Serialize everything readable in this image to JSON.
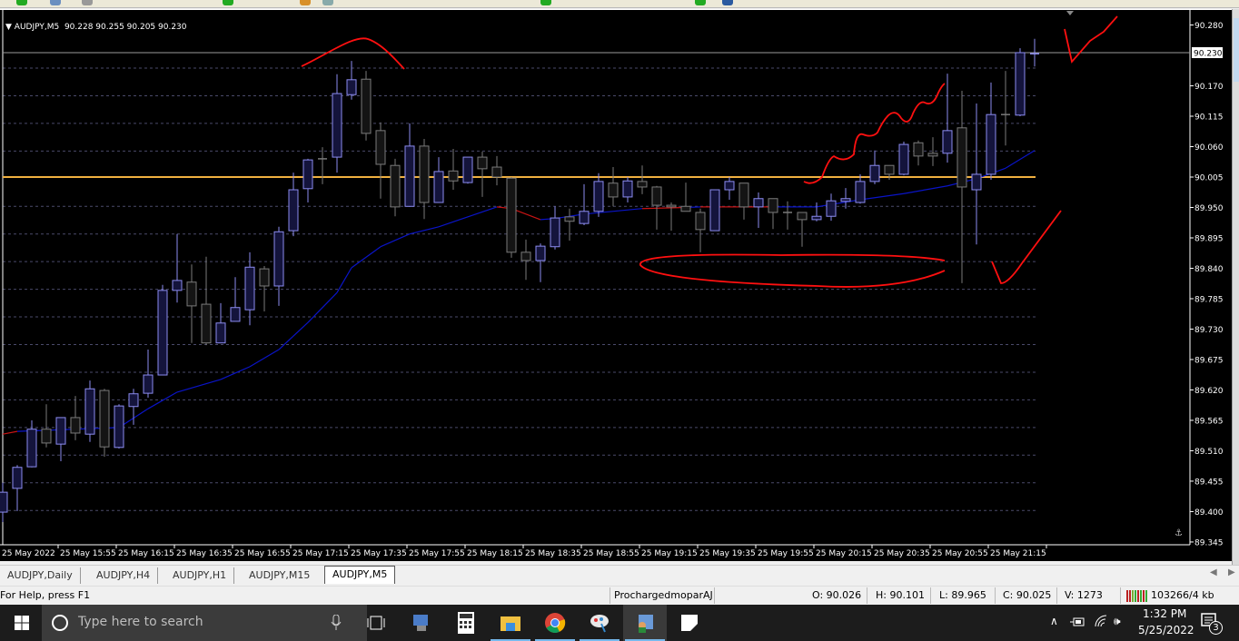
{
  "chart": {
    "symbol_label": "AUDJPY,M5",
    "ohlc_label": "90.228 90.255 90.205 90.230",
    "current_price": "90.230",
    "horizontal_line_price": 90.005,
    "colors": {
      "background": "#000000",
      "bull_outline": "#8c8cf0",
      "bull_fill": "#14143c",
      "bear_outline": "#7a7a7a",
      "bear_fill": "#141414",
      "ma_line": "#0a14c8",
      "ma_line_alt": "#c81414",
      "horizontal_line": "#f0b040",
      "grid": "#4a4a6a",
      "annotation": "#ff1010"
    }
  },
  "chart_data": {
    "type": "candlestick",
    "title": "AUDJPY,M5",
    "grid": true,
    "ylim": [
      89.345,
      90.305
    ],
    "y_tick_labels": [
      "90.280",
      "90.170",
      "90.115",
      "90.060",
      "90.005",
      "89.950",
      "89.895",
      "89.840",
      "89.785",
      "89.730",
      "89.675",
      "89.620",
      "89.565",
      "89.510",
      "89.455",
      "89.400",
      "89.345"
    ],
    "x_tick_labels": [
      "25 May 2022",
      "25 May 15:55",
      "25 May 16:15",
      "25 May 16:35",
      "25 May 16:55",
      "25 May 17:15",
      "25 May 17:35",
      "25 May 17:55",
      "25 May 18:15",
      "25 May 18:35",
      "25 May 18:55",
      "25 May 19:15",
      "25 May 19:35",
      "25 May 19:55",
      "25 May 20:15",
      "25 May 20:35",
      "25 May 20:55",
      "25 May 21:15"
    ],
    "candles_ohlc": [
      [
        89.399,
        89.452,
        89.381,
        89.435
      ],
      [
        89.442,
        89.484,
        89.401,
        89.48
      ],
      [
        89.481,
        89.565,
        89.48,
        89.549
      ],
      [
        89.549,
        89.594,
        89.516,
        89.524
      ],
      [
        89.522,
        89.57,
        89.491,
        89.57
      ],
      [
        89.57,
        89.609,
        89.529,
        89.542
      ],
      [
        89.54,
        89.637,
        89.526,
        89.622
      ],
      [
        89.619,
        89.622,
        89.499,
        89.517
      ],
      [
        89.516,
        89.594,
        89.514,
        89.591
      ],
      [
        89.59,
        89.622,
        89.557,
        89.613
      ],
      [
        89.614,
        89.693,
        89.606,
        89.647
      ],
      [
        89.647,
        89.81,
        89.647,
        89.8
      ],
      [
        89.8,
        89.902,
        89.778,
        89.818
      ],
      [
        89.815,
        89.847,
        89.705,
        89.772
      ],
      [
        89.775,
        89.861,
        89.701,
        89.705
      ],
      [
        89.705,
        89.777,
        89.705,
        89.741
      ],
      [
        89.744,
        89.824,
        89.744,
        89.769
      ],
      [
        89.765,
        89.869,
        89.737,
        89.842
      ],
      [
        89.839,
        89.844,
        89.762,
        89.808
      ],
      [
        89.808,
        89.915,
        89.772,
        89.906
      ],
      [
        89.908,
        90.013,
        89.898,
        89.982
      ],
      [
        89.984,
        90.038,
        89.959,
        90.036
      ],
      [
        90.038,
        90.059,
        89.992,
        90.038
      ],
      [
        90.041,
        90.191,
        90.013,
        90.156
      ],
      [
        90.154,
        90.215,
        90.145,
        90.181
      ],
      [
        90.182,
        90.197,
        90.071,
        90.084
      ],
      [
        90.089,
        90.104,
        89.966,
        90.028
      ],
      [
        90.026,
        90.038,
        89.934,
        89.951
      ],
      [
        89.952,
        90.102,
        89.951,
        90.061
      ],
      [
        90.061,
        90.074,
        89.929,
        89.959
      ],
      [
        89.959,
        90.041,
        89.959,
        90.015
      ],
      [
        90.016,
        90.056,
        89.982,
        89.998
      ],
      [
        89.995,
        90.041,
        89.993,
        90.041
      ],
      [
        90.041,
        90.051,
        89.969,
        90.02
      ],
      [
        90.023,
        90.043,
        89.99,
        90.005
      ],
      [
        90.003,
        90.005,
        89.859,
        89.869
      ],
      [
        89.869,
        89.892,
        89.819,
        89.854
      ],
      [
        89.854,
        89.885,
        89.815,
        89.88
      ],
      [
        89.879,
        89.952,
        89.874,
        89.931
      ],
      [
        89.933,
        89.948,
        89.89,
        89.925
      ],
      [
        89.921,
        89.992,
        89.918,
        89.943
      ],
      [
        89.943,
        90.012,
        89.933,
        89.997
      ],
      [
        89.994,
        90.023,
        89.952,
        89.969
      ],
      [
        89.969,
        90.005,
        89.959,
        89.998
      ],
      [
        89.997,
        90.026,
        89.974,
        89.987
      ],
      [
        89.987,
        89.989,
        89.91,
        89.954
      ],
      [
        89.954,
        89.959,
        89.908,
        89.951
      ],
      [
        89.952,
        89.995,
        89.943,
        89.943
      ],
      [
        89.941,
        89.948,
        89.869,
        89.91
      ],
      [
        89.908,
        89.982,
        89.908,
        89.982
      ],
      [
        89.982,
        90.005,
        89.964,
        89.997
      ],
      [
        89.994,
        89.994,
        89.928,
        89.951
      ],
      [
        89.951,
        89.977,
        89.913,
        89.966
      ],
      [
        89.966,
        89.966,
        89.911,
        89.941
      ],
      [
        89.941,
        89.961,
        89.91,
        89.941
      ],
      [
        89.941,
        89.941,
        89.879,
        89.928
      ],
      [
        89.928,
        89.959,
        89.925,
        89.934
      ],
      [
        89.934,
        89.975,
        89.926,
        89.962
      ],
      [
        89.961,
        89.985,
        89.948,
        89.966
      ],
      [
        89.959,
        90.01,
        89.957,
        89.997
      ],
      [
        89.997,
        90.053,
        89.992,
        90.026
      ],
      [
        90.026,
        90.026,
        90.0,
        90.01
      ],
      [
        90.01,
        90.069,
        90.008,
        90.064
      ],
      [
        90.067,
        90.071,
        90.026,
        90.043
      ],
      [
        90.048,
        90.077,
        90.025,
        90.043
      ],
      [
        90.048,
        90.192,
        90.031,
        90.089
      ],
      [
        90.094,
        90.161,
        89.813,
        89.987
      ],
      [
        89.982,
        90.138,
        89.883,
        90.01
      ],
      [
        90.01,
        90.176,
        90.0,
        90.118
      ],
      [
        90.118,
        90.197,
        90.062,
        90.118
      ],
      [
        90.117,
        90.238,
        90.115,
        90.23
      ],
      [
        90.228,
        90.255,
        90.205,
        90.23
      ]
    ],
    "moving_average": [
      [
        0,
        89.54,
        "red"
      ],
      [
        1,
        89.545,
        "red"
      ],
      [
        8,
        89.552,
        "blue"
      ],
      [
        10,
        89.586,
        "blue"
      ],
      [
        12,
        89.616,
        "blue"
      ],
      [
        15,
        89.639,
        "blue"
      ],
      [
        17,
        89.662,
        "blue"
      ],
      [
        19,
        89.693,
        "blue"
      ],
      [
        21,
        89.742,
        "blue"
      ],
      [
        23,
        89.796,
        "blue"
      ],
      [
        24,
        89.841,
        "blue"
      ],
      [
        26,
        89.879,
        "blue"
      ],
      [
        28,
        89.902,
        "blue"
      ],
      [
        30,
        89.915,
        "blue"
      ],
      [
        34,
        89.951,
        "blue"
      ],
      [
        35,
        89.948,
        "red"
      ],
      [
        37,
        89.928,
        "red"
      ],
      [
        38,
        89.93,
        "blue"
      ],
      [
        40,
        89.938,
        "blue"
      ],
      [
        44,
        89.948,
        "blue"
      ],
      [
        47,
        89.95,
        "red"
      ],
      [
        48,
        89.951,
        "blue"
      ],
      [
        53,
        89.951,
        "red"
      ],
      [
        56,
        89.951,
        "blue"
      ],
      [
        59,
        89.964,
        "blue"
      ],
      [
        62,
        89.975,
        "blue"
      ],
      [
        65,
        89.989,
        "blue"
      ],
      [
        67,
        90.002,
        "blue"
      ],
      [
        69,
        90.021,
        "blue"
      ],
      [
        71,
        90.053,
        "blue"
      ]
    ]
  },
  "tabs": [
    {
      "label": "AUDJPY,Daily",
      "active": false
    },
    {
      "label": "AUDJPY,H4",
      "active": false
    },
    {
      "label": "AUDJPY,H1",
      "active": false
    },
    {
      "label": "AUDJPY,M15",
      "active": false
    },
    {
      "label": "AUDJPY,M5",
      "active": true
    }
  ],
  "status": {
    "help": "For Help, press F1",
    "profile": "ProchargedmoparAJ",
    "open": "O: 90.026",
    "high": "H: 90.101",
    "low": "L: 89.965",
    "close": "C: 90.025",
    "volume": "V: 1273",
    "traffic": "103266/4 kb"
  },
  "taskbar": {
    "search_placeholder": "Type here to search",
    "time": "1:32 PM",
    "date": "5/25/2022",
    "notification_count": "3",
    "apps": [
      "task-view-icon",
      "network-app-icon",
      "calculator-icon",
      "file-explorer-icon",
      "chrome-icon",
      "paint-icon",
      "metatrader-icon",
      "sticky-app-icon"
    ]
  }
}
